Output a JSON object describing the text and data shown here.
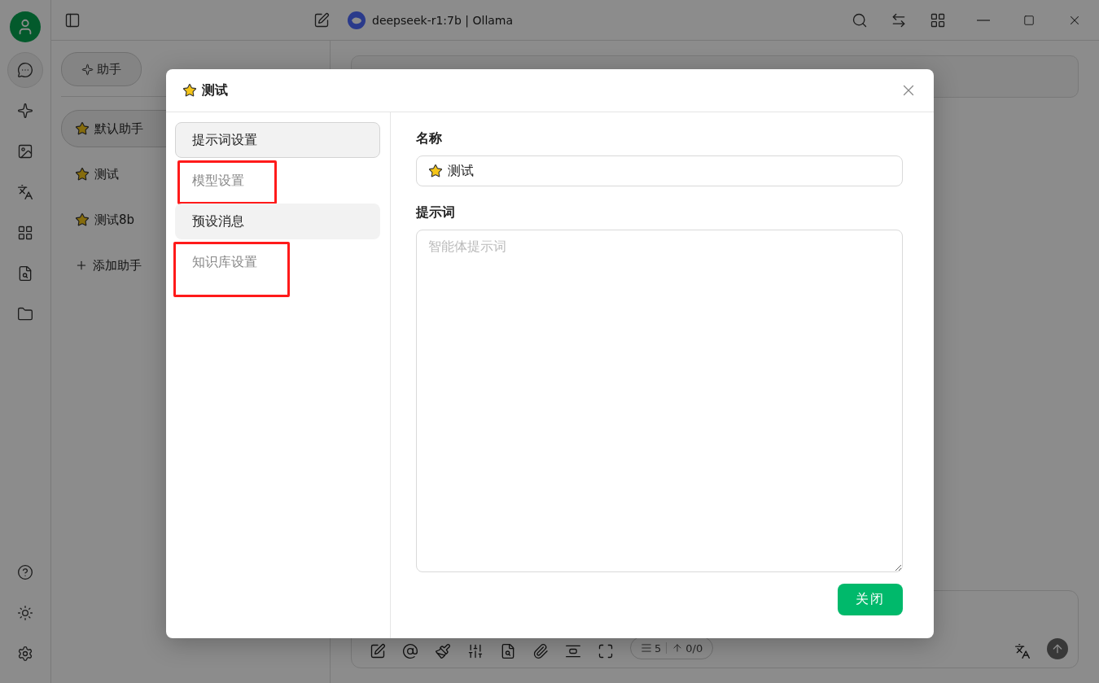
{
  "titlebar": {
    "model": "deepseek-r1:7b | Ollama"
  },
  "rail": {
    "items": [
      {
        "selected": true
      },
      {
        "selected": false
      },
      {
        "selected": false
      },
      {
        "selected": false
      },
      {
        "selected": false
      },
      {
        "selected": false
      },
      {
        "selected": false
      }
    ]
  },
  "assistant_panel": {
    "tabs": [
      {
        "label": "助手",
        "selected": true
      }
    ],
    "assistants": [
      {
        "name": "默认助手",
        "selected": true
      },
      {
        "name": "测试",
        "selected": false
      },
      {
        "name": "测试8b",
        "selected": false
      }
    ],
    "add_label": "添加助手"
  },
  "input_toolbar": {
    "context_count": "5",
    "token_count": "0/0"
  },
  "dialog": {
    "title": "测试",
    "menu": [
      {
        "label": "提示词设置",
        "selected": true,
        "hovered": false,
        "annotated": false
      },
      {
        "label": "模型设置",
        "selected": false,
        "hovered": false,
        "annotated": true
      },
      {
        "label": "预设消息",
        "selected": false,
        "hovered": true,
        "annotated": false
      },
      {
        "label": "知识库设置",
        "selected": false,
        "hovered": false,
        "annotated": true
      }
    ],
    "name_label": "名称",
    "name_value": "测试",
    "prompt_label": "提示词",
    "prompt_placeholder": "智能体提示词",
    "close_button": "关闭"
  }
}
